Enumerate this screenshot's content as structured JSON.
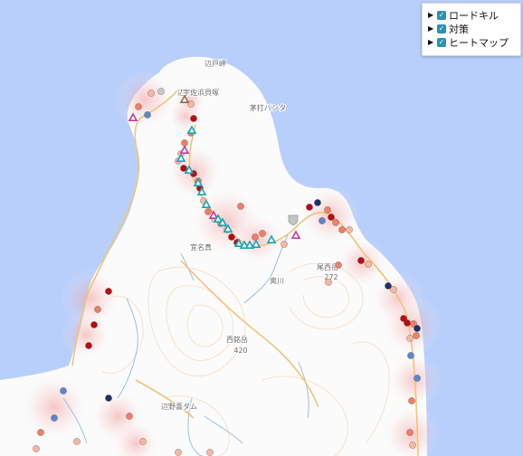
{
  "legend": {
    "items": [
      {
        "label": "ロードキル",
        "checked": true
      },
      {
        "label": "対策",
        "checked": true
      },
      {
        "label": "ヒートマップ",
        "checked": true
      }
    ]
  },
  "map_labels": {
    "cape": "辺戸岬",
    "cape_area": "辺戸",
    "place_1": "宇佐浜貝塚",
    "shore": "茅打バンタ",
    "village": "宜名真",
    "river": "奥川",
    "peak_nishi": "西銘岳",
    "elev_nishi": "420",
    "peak_o": "尾西岳",
    "elev_o": "272",
    "dam": "辺野喜ダム"
  },
  "colors": {
    "sea": "#b8cffb",
    "land": "#fbfbfb",
    "road": "#f2c377",
    "contour": "#f6dcc4",
    "stream": "#9cbfe0",
    "heat": "#f0a1a1",
    "roadkill_dark": "#b60c14",
    "roadkill_mid": "#ee7f68",
    "roadkill_light": "#f6b7a3",
    "roadkill_blue": "#5a86cd",
    "roadkill_navy": "#17336e",
    "measure_cyan": "#15a7b8",
    "measure_magenta": "#c03aa6",
    "measure_brown": "#8f6a4e"
  }
}
